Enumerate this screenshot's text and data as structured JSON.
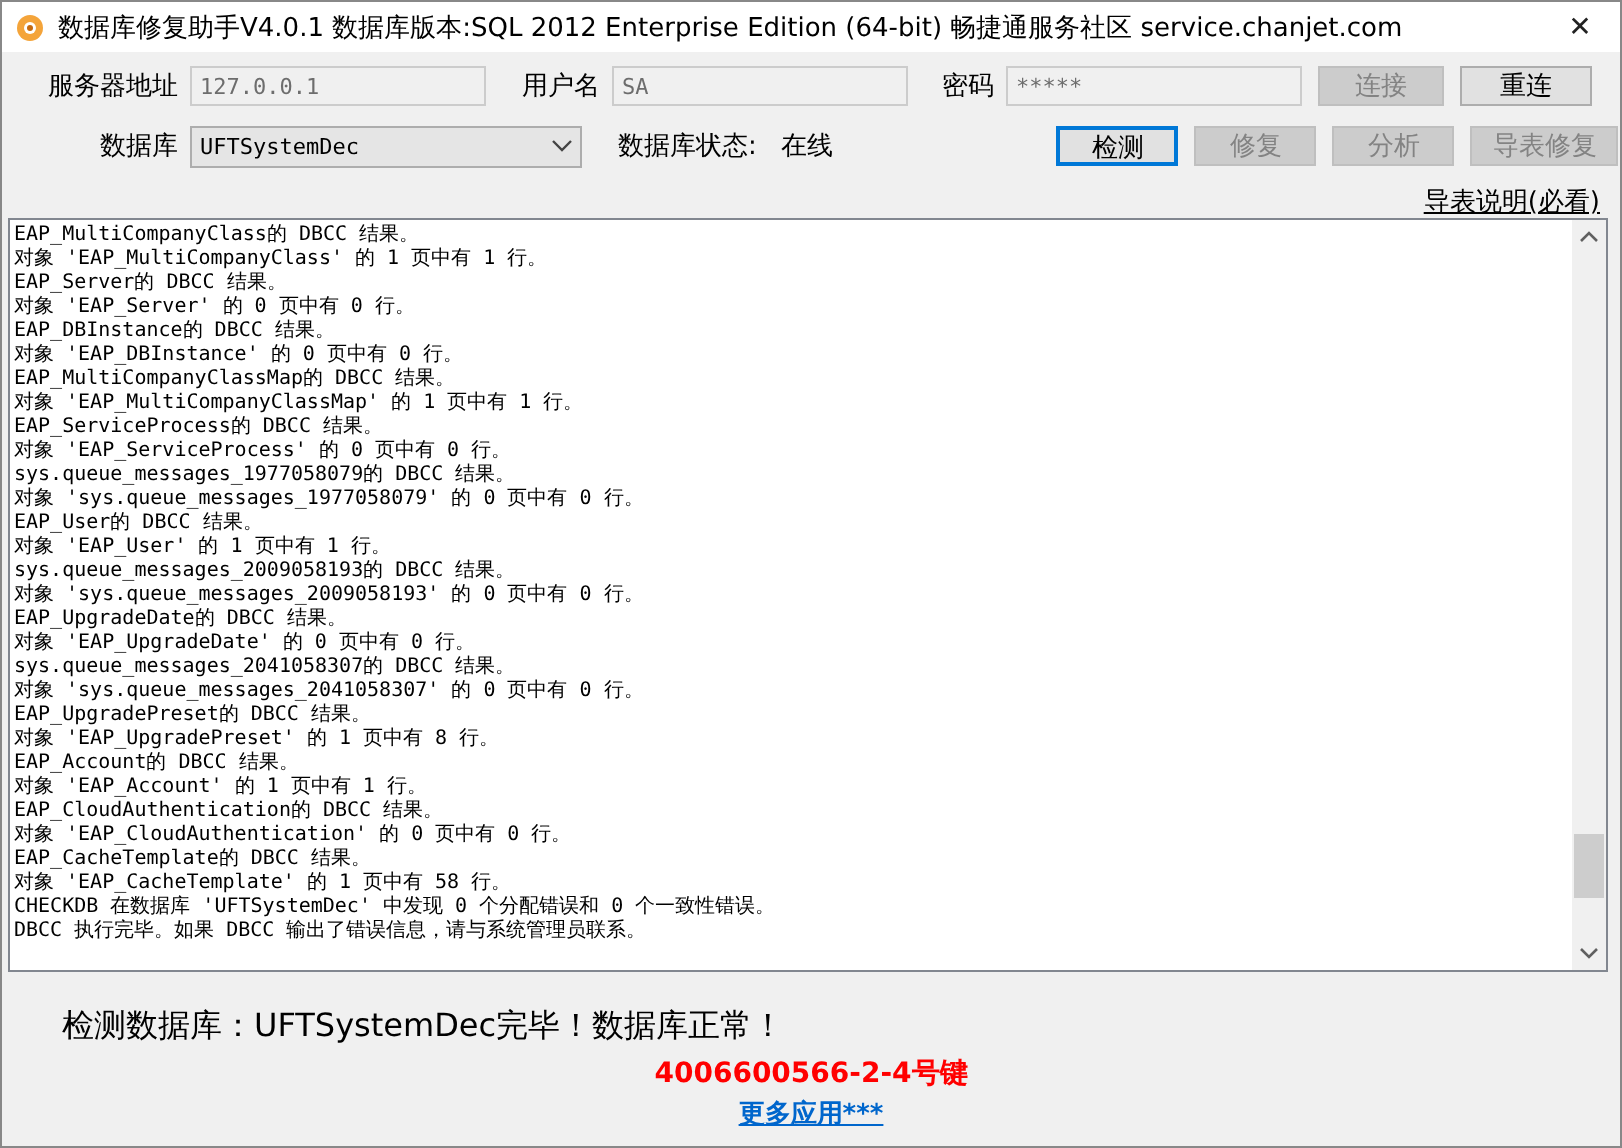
{
  "window": {
    "title": "数据库修复助手V4.0.1 数据库版本:SQL 2012 Enterprise Edition (64-bit)  畅捷通服务社区 service.chanjet.com",
    "close": "✕"
  },
  "connection": {
    "fields": [
      {
        "label": "服务器地址",
        "value": "127.0.0.1",
        "disabled": true
      },
      {
        "label": "用户名",
        "value": "SA",
        "disabled": true
      },
      {
        "label": "密码",
        "value": "*****",
        "disabled": true
      }
    ],
    "buttons": [
      {
        "label": "连接",
        "disabled": true,
        "focused": false
      },
      {
        "label": "重连",
        "disabled": false,
        "focused": false
      }
    ]
  },
  "database": {
    "label": "数据库",
    "value": "UFTSystemDec",
    "status_label": "数据库状态:",
    "status": "在线",
    "buttons": [
      {
        "label": "检测",
        "disabled": false,
        "focused": true
      },
      {
        "label": "修复",
        "disabled": true,
        "focused": false
      },
      {
        "label": "分析",
        "disabled": true,
        "focused": false
      },
      {
        "label": "导表修复",
        "disabled": true,
        "focused": false
      }
    ]
  },
  "help_link": "导表说明(必看)",
  "log": [
    "EAP_MultiCompanyClass的 DBCC 结果。",
    "对象 'EAP_MultiCompanyClass' 的 1 页中有 1 行。",
    "EAP_Server的 DBCC 结果。",
    "对象 'EAP_Server' 的 0 页中有 0 行。",
    "EAP_DBInstance的 DBCC 结果。",
    "对象 'EAP_DBInstance' 的 0 页中有 0 行。",
    "EAP_MultiCompanyClassMap的 DBCC 结果。",
    "对象 'EAP_MultiCompanyClassMap' 的 1 页中有 1 行。",
    "EAP_ServiceProcess的 DBCC 结果。",
    "对象 'EAP_ServiceProcess' 的 0 页中有 0 行。",
    "sys.queue_messages_1977058079的 DBCC 结果。",
    "对象 'sys.queue_messages_1977058079' 的 0 页中有 0 行。",
    "EAP_User的 DBCC 结果。",
    "对象 'EAP_User' 的 1 页中有 1 行。",
    "sys.queue_messages_2009058193的 DBCC 结果。",
    "对象 'sys.queue_messages_2009058193' 的 0 页中有 0 行。",
    "EAP_UpgradeDate的 DBCC 结果。",
    "对象 'EAP_UpgradeDate' 的 0 页中有 0 行。",
    "sys.queue_messages_2041058307的 DBCC 结果。",
    "对象 'sys.queue_messages_2041058307' 的 0 页中有 0 行。",
    "EAP_UpgradePreset的 DBCC 结果。",
    "对象 'EAP_UpgradePreset' 的 1 页中有 8 行。",
    "EAP_Account的 DBCC 结果。",
    "对象 'EAP_Account' 的 1 页中有 1 行。",
    "EAP_CloudAuthentication的 DBCC 结果。",
    "对象 'EAP_CloudAuthentication' 的 0 页中有 0 行。",
    "EAP_CacheTemplate的 DBCC 结果。",
    "对象 'EAP_CacheTemplate' 的 1 页中有 58 行。",
    "CHECKDB 在数据库 'UFTSystemDec' 中发现 0 个分配错误和 0 个一致性错误。",
    "DBCC 执行完毕。如果 DBCC 输出了错误信息，请与系统管理员联系。"
  ],
  "result": "检测数据库：UFTSystemDec完毕！数据库正常！",
  "hotline": "4006600566-2-4号键",
  "more_link": "更多应用***"
}
